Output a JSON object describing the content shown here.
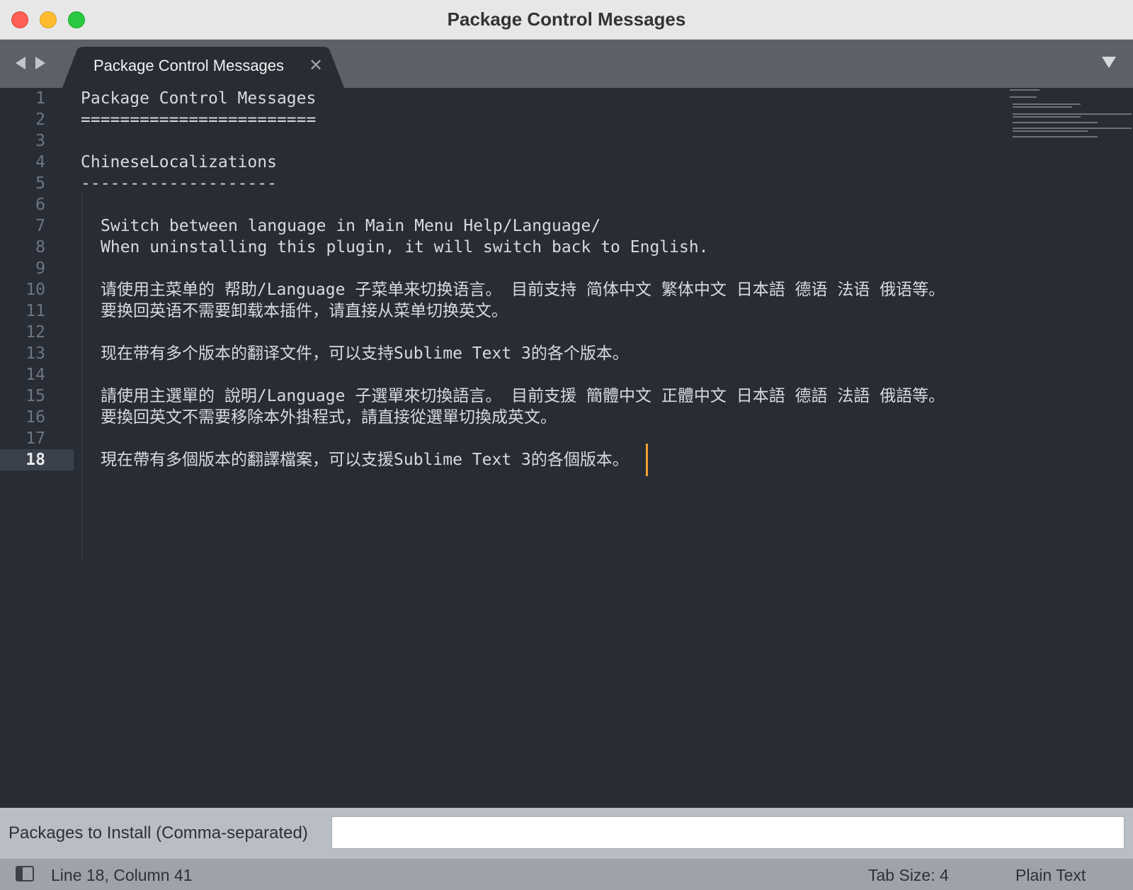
{
  "window": {
    "title": "Package Control Messages"
  },
  "tabs": [
    {
      "label": "Package Control Messages",
      "close_glyph": "✕",
      "active": true
    }
  ],
  "editor": {
    "active_line": 18,
    "gutter": [
      "1",
      "2",
      "3",
      "4",
      "5",
      "6",
      "7",
      "8",
      "9",
      "10",
      "11",
      "12",
      "13",
      "14",
      "15",
      "16",
      "17",
      "18"
    ],
    "lines": [
      "Package Control Messages",
      "========================",
      "",
      "ChineseLocalizations",
      "--------------------",
      "",
      "Switch between language in Main Menu Help/Language/",
      "When uninstalling this plugin, it will switch back to English.",
      "",
      "请使用主菜单的 帮助/Language 子菜单来切换语言。 目前支持 简体中文 繁体中文 日本語 德语 法语 俄语等。",
      "要换回英语不需要卸载本插件，请直接从菜单切换英文。",
      "",
      "现在带有多个版本的翻译文件，可以支持Sublime Text 3的各个版本。",
      "",
      "請使用主選單的 說明/Language 子選單來切換語言。 目前支援 簡體中文 正體中文 日本語 德語 法語 俄語等。",
      "要換回英文不需要移除本外掛程式，請直接從選單切換成英文。",
      "",
      "現在帶有多個版本的翻譯檔案，可以支援Sublime Text 3的各個版本。"
    ]
  },
  "input_panel": {
    "label": "Packages to Install (Comma-separated)",
    "value": "",
    "placeholder": ""
  },
  "status_bar": {
    "position": "Line 18, Column 41",
    "tab_size": "Tab Size: 4",
    "syntax": "Plain Text"
  },
  "colors": {
    "editor_bg": "#272c35",
    "tabbar_bg": "#5c6069",
    "cursor": "#f0a030",
    "text": "#d8dadf"
  },
  "icons": {
    "nav_back": "triangle-left-icon",
    "nav_forward": "triangle-right-icon",
    "tab_close": "close-icon",
    "tab_menu": "chevron-down-icon",
    "panel_toggle": "sidebar-toggle-icon"
  }
}
